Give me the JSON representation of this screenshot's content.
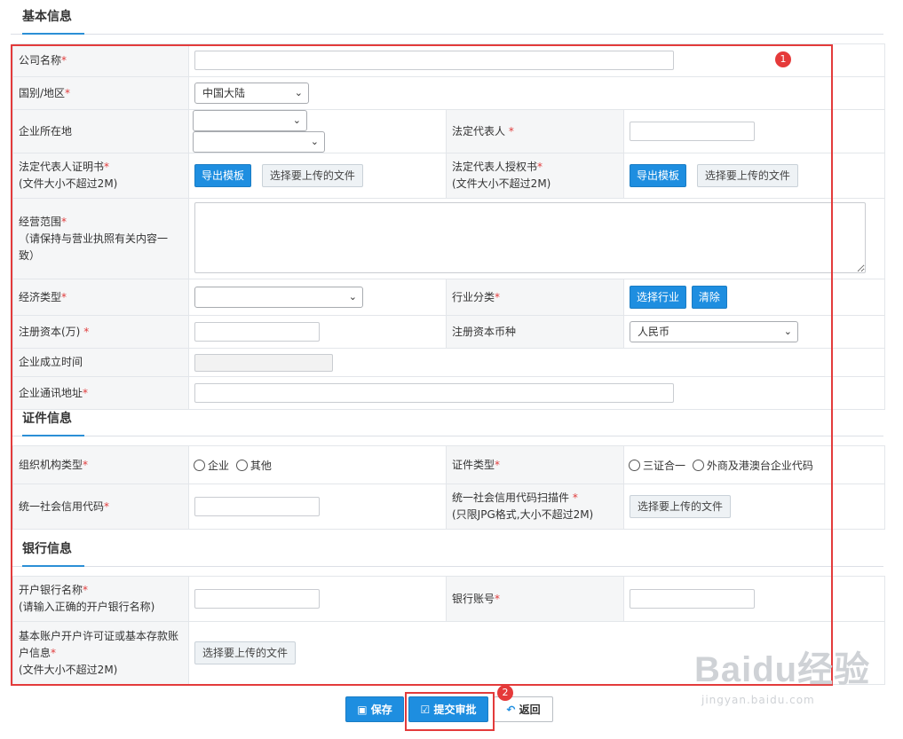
{
  "sections": {
    "basic": "基本信息",
    "certificate": "证件信息",
    "bank": "银行信息"
  },
  "basic": {
    "company_name_label": "公司名称",
    "country_label": "国别/地区",
    "country_value": "中国大陆",
    "location_label": "企业所在地",
    "legal_rep_label": "法定代表人",
    "legal_rep_cert_label": "法定代表人证明书",
    "legal_rep_auth_label": "法定代表人授权书",
    "size_note": "(文件大小不超过2M)",
    "export_template": "导出模板",
    "choose_file": "选择要上传的文件",
    "business_scope_label": "经营范围",
    "business_scope_note": "（请保持与营业执照有关内容一致）",
    "economic_type_label": "经济类型",
    "industry_label": "行业分类",
    "choose_industry": "选择行业",
    "clear": "清除",
    "reg_capital_label": "注册资本(万)",
    "reg_currency_label": "注册资本币种",
    "reg_currency_value": "人民币",
    "established_label": "企业成立时间",
    "address_label": "企业通讯地址"
  },
  "certificate": {
    "org_type_label": "组织机构类型",
    "org_opt_company": "企业",
    "org_opt_other": "其他",
    "cert_type_label": "证件类型",
    "cert_opt_1": "三证合一",
    "cert_opt_2": "外商及港澳台企业代码",
    "credit_code_label": "统一社会信用代码",
    "credit_scan_label": "统一社会信用代码扫描件",
    "credit_scan_note": "(只限JPG格式,大小不超过2M)",
    "choose_file": "选择要上传的文件"
  },
  "bank": {
    "bank_name_label": "开户银行名称",
    "bank_name_note": "(请输入正确的开户银行名称)",
    "account_label": "银行账号",
    "permit_label": "基本账户开户许可证或基本存款账户信息",
    "permit_note": "(文件大小不超过2M)",
    "choose_file": "选择要上传的文件"
  },
  "actions": {
    "save": "保存",
    "submit": "提交审批",
    "back": "返回"
  },
  "annotations": {
    "badge1": "1",
    "badge2": "2"
  },
  "watermark": {
    "brand": "Baidu经验",
    "url": "jingyan.baidu.com"
  },
  "colors": {
    "primary": "#1e8ee0",
    "required": "#e03c3c",
    "highlight": "#e33b3b"
  }
}
